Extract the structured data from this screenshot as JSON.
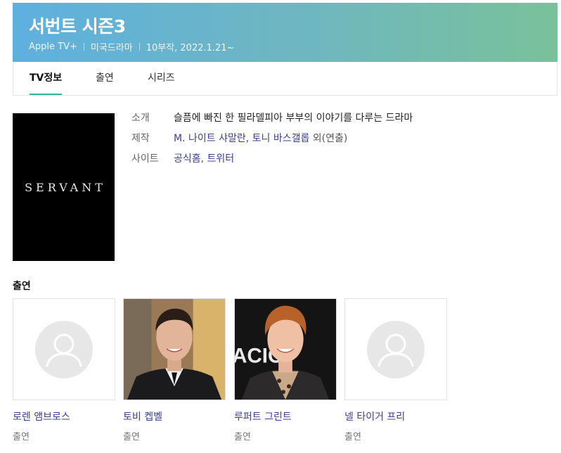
{
  "header": {
    "title": "서번트 시즌3",
    "meta": [
      "Apple TV+",
      "미국드라마",
      "10부작, 2022.1.21~"
    ],
    "gradient_start": "#5eb0df",
    "gradient_end": "#79c19a"
  },
  "tabs": [
    {
      "label": "TV정보",
      "active": true
    },
    {
      "label": "출연",
      "active": false
    },
    {
      "label": "시리즈",
      "active": false
    }
  ],
  "poster": {
    "text": "SERVANT"
  },
  "info": {
    "intro_label": "소개",
    "intro_value": "슬픔에 빠진 한 필라델피아 부부의 이야기를 다루는 드라마",
    "production_label": "제작",
    "production_link": "M. 나이트 샤말란, 토니 바스갤롭",
    "production_suffix": "외(연출)",
    "site_label": "사이트",
    "site_links": [
      "공식홈",
      "트위터"
    ]
  },
  "cast": {
    "heading": "출연",
    "members": [
      {
        "name": "로렌 앰브로스",
        "role": "출연",
        "photo": "placeholder-avatar-icon"
      },
      {
        "name": "토비 켑벨",
        "role": "출연",
        "photo": "actor-photo"
      },
      {
        "name": "루퍼트 그린트",
        "role": "출연",
        "photo": "actor-photo"
      },
      {
        "name": "넬 타이거 프리",
        "role": "출연",
        "photo": "placeholder-avatar-icon"
      }
    ]
  },
  "colors": {
    "accent": "#30b79a",
    "link": "#3a3f8c"
  }
}
